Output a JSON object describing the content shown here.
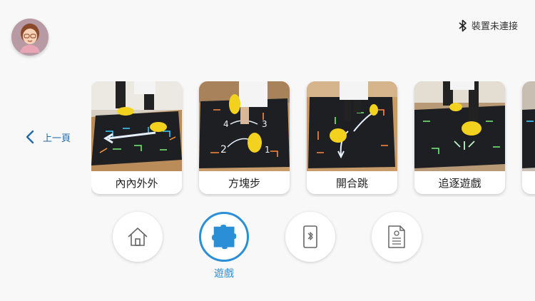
{
  "header": {
    "bluetooth_icon": "bluetooth-icon",
    "bluetooth_status": "裝置未連接"
  },
  "avatar": {
    "icon": "grandma-avatar"
  },
  "back": {
    "label": "上一頁",
    "icon": "chevron-left-icon"
  },
  "games": [
    {
      "label": "內內外外"
    },
    {
      "label": "方塊步"
    },
    {
      "label": "開合跳"
    },
    {
      "label": "追逐遊戲"
    }
  ],
  "bottom_nav": {
    "items": [
      {
        "icon": "home-icon",
        "label": ""
      },
      {
        "icon": "puzzle-icon",
        "label": "遊戲",
        "active": true
      },
      {
        "icon": "phone-bluetooth-icon",
        "label": ""
      },
      {
        "icon": "document-icon",
        "label": ""
      }
    ]
  },
  "colors": {
    "accent": "#2b8fd8",
    "back_link": "#1f6aa8",
    "background": "#f8f8f8",
    "avatar_bg": "#b79aa3"
  }
}
